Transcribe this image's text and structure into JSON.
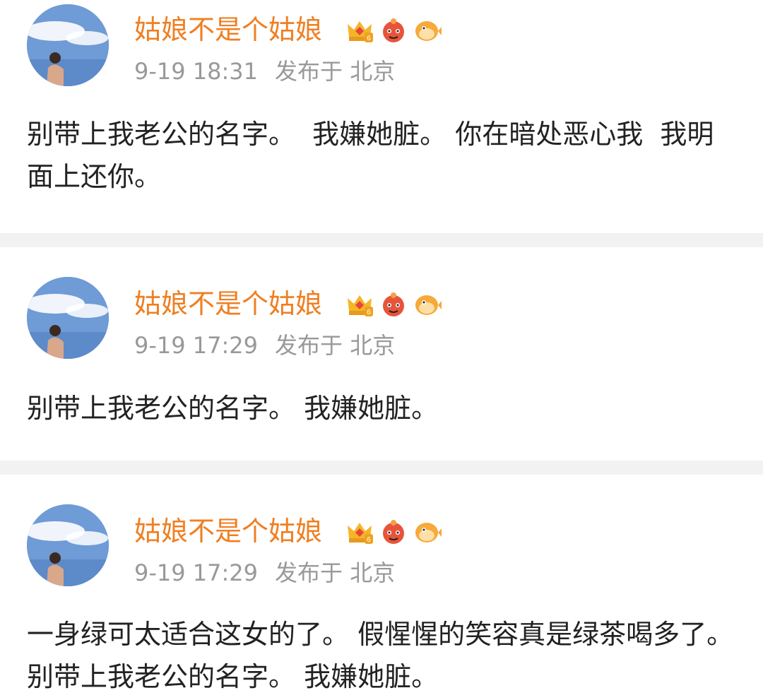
{
  "posts": [
    {
      "username": "姑娘不是个姑娘",
      "time": "9-19 18:31",
      "location": "发布于 北京",
      "text": "别带上我老公的名字。  我嫌她脏。 你在暗处恶心我  我明面上还你。",
      "badges": [
        "crown-level-6-icon",
        "cartoon-mascot-icon",
        "pufferfish-icon"
      ]
    },
    {
      "username": "姑娘不是个姑娘",
      "time": "9-19 17:29",
      "location": "发布于 北京",
      "text": "别带上我老公的名字。 我嫌她脏。",
      "badges": [
        "crown-level-6-icon",
        "cartoon-mascot-icon",
        "pufferfish-icon"
      ]
    },
    {
      "username": "姑娘不是个姑娘",
      "time": "9-19 17:29",
      "location": "发布于 北京",
      "text": "一身绿可太适合这女的了。 假惺惺的笑容真是绿茶喝多了。 别带上我老公的名字。 我嫌她脏。",
      "badges": [
        "crown-level-6-icon",
        "cartoon-mascot-icon",
        "pufferfish-icon"
      ]
    }
  ],
  "colors": {
    "username": "#ef7f22",
    "meta": "#999999",
    "text": "#222222",
    "divider": "#f2f2f2"
  }
}
